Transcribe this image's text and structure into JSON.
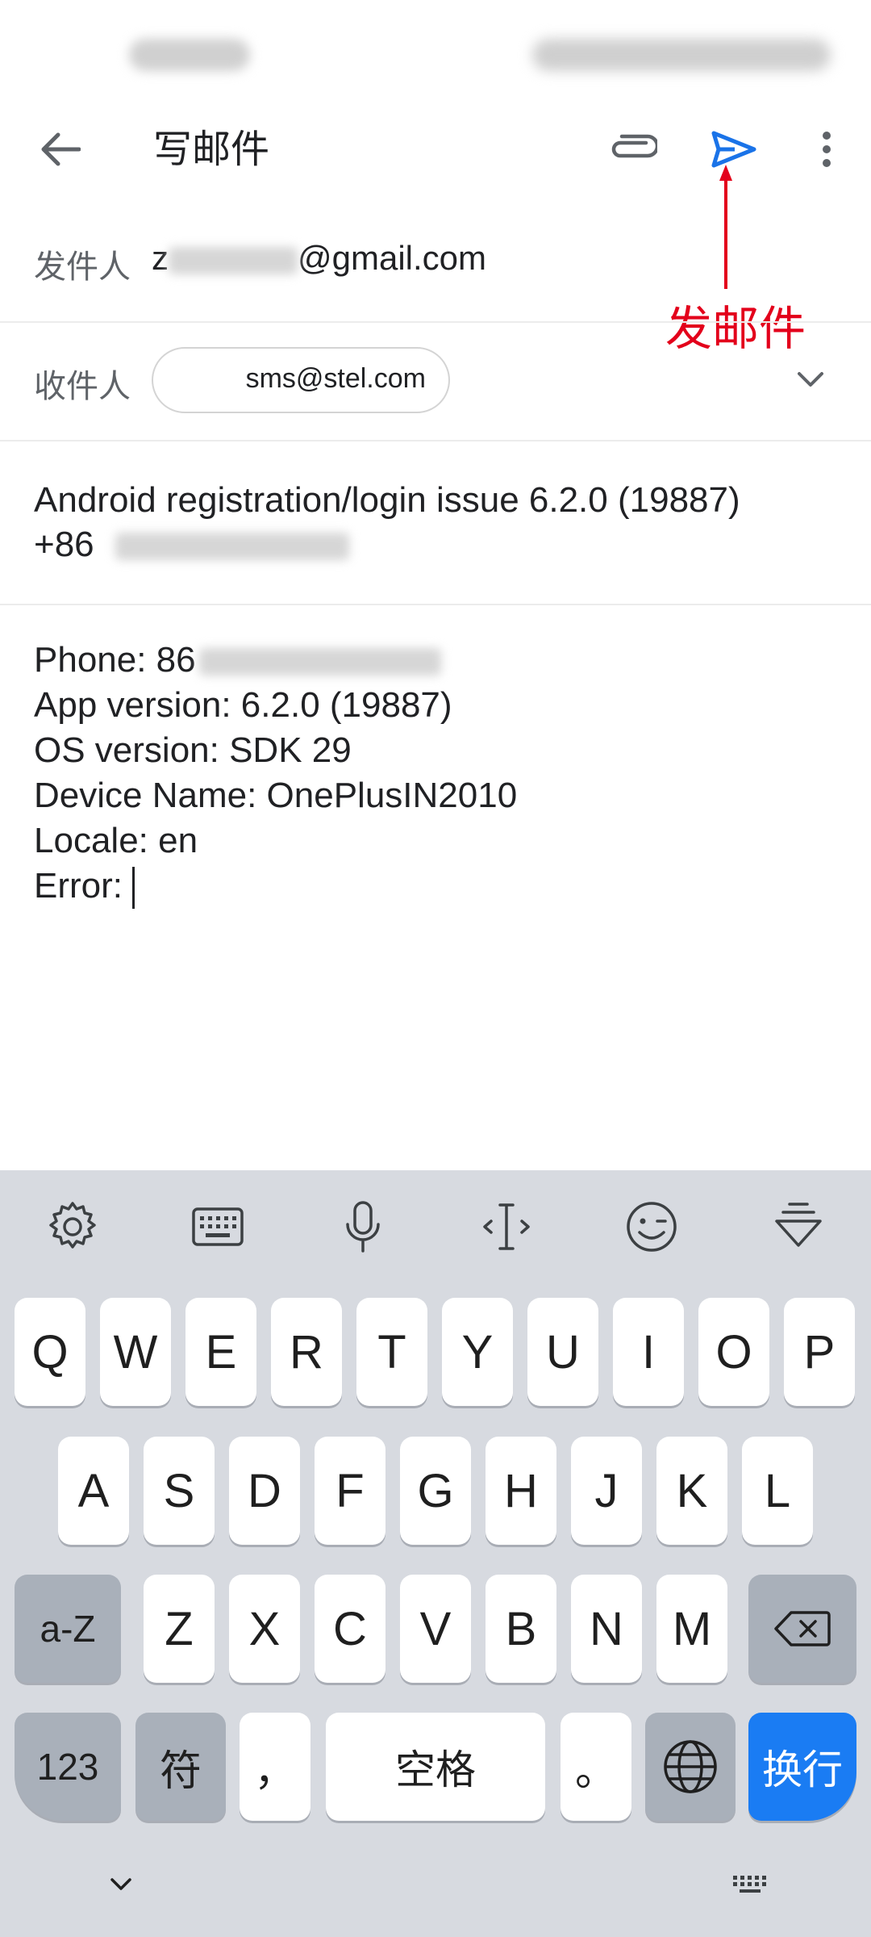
{
  "app_bar": {
    "title": "写邮件"
  },
  "annotation": {
    "label": "发邮件",
    "color": "#e3001b"
  },
  "from": {
    "label": "发件人",
    "value_prefix": "z",
    "value_suffix": "@gmail.com"
  },
  "to": {
    "label": "收件人",
    "chip": "sms@stel.com"
  },
  "subject": {
    "line1": "Android registration/login issue 6.2.0 (19887)",
    "line2_prefix": "+86"
  },
  "body": {
    "phone_prefix": "Phone: 86",
    "app_version": "App version: 6.2.0 (19887)",
    "os_version": "OS version: SDK 29",
    "device_name": "Device Name: OnePlusIN2010",
    "locale": "Locale: en",
    "error": "Error:"
  },
  "keyboard": {
    "row1": [
      "Q",
      "W",
      "E",
      "R",
      "T",
      "Y",
      "U",
      "I",
      "O",
      "P"
    ],
    "row2": [
      "A",
      "S",
      "D",
      "F",
      "G",
      "H",
      "J",
      "K",
      "L"
    ],
    "row3": [
      "Z",
      "X",
      "C",
      "V",
      "B",
      "N",
      "M"
    ],
    "shift_label": "a-Z",
    "numbers_label": "123",
    "symbols_label": "符",
    "comma_label": "，",
    "space_label": "空格",
    "period_label": "。",
    "enter_label": "换行",
    "accent_color": "#1a7cf3"
  },
  "icons": {
    "back": "back-arrow-icon",
    "attach": "paperclip-icon",
    "send": "send-icon",
    "more": "more-vert-icon",
    "expand": "chevron-down-icon",
    "settings": "gear-icon",
    "keyboard": "keyboard-icon",
    "mic": "microphone-icon",
    "cursor": "cursor-move-icon",
    "emoji": "emoji-icon",
    "hide": "hide-keyboard-icon",
    "backspace": "backspace-icon",
    "globe": "globe-icon"
  }
}
